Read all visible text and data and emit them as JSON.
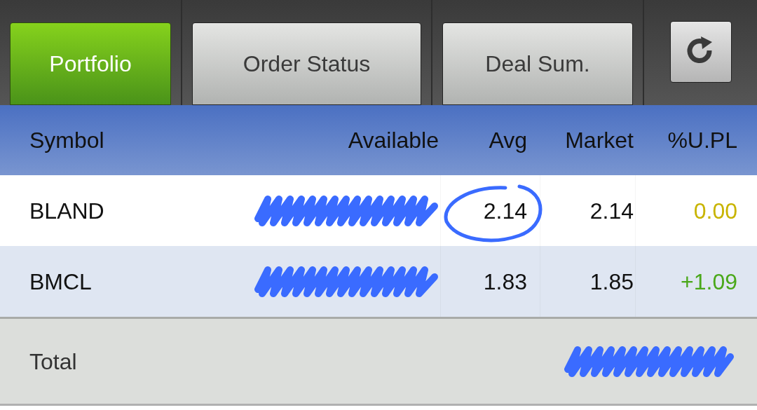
{
  "tabs": [
    {
      "label": "Portfolio",
      "selected": true
    },
    {
      "label": "Order Status",
      "selected": false
    },
    {
      "label": "Deal Sum.",
      "selected": false
    }
  ],
  "table": {
    "columns": [
      "Symbol",
      "Available",
      "Avg",
      "Market",
      "%U.PL"
    ],
    "rows": [
      {
        "symbol": "BLAND",
        "available_redacted": true,
        "avg": "2.14",
        "avg_circled": true,
        "market": "2.14",
        "upl": "0.00",
        "color": "#c8b400"
      },
      {
        "symbol": "BMCL",
        "available_redacted": true,
        "avg": "1.83",
        "avg_circled": false,
        "market": "1.85",
        "upl": "+1.09",
        "color": "#4aa81a"
      }
    ]
  },
  "total": {
    "label": "Total",
    "value_redacted": true
  }
}
